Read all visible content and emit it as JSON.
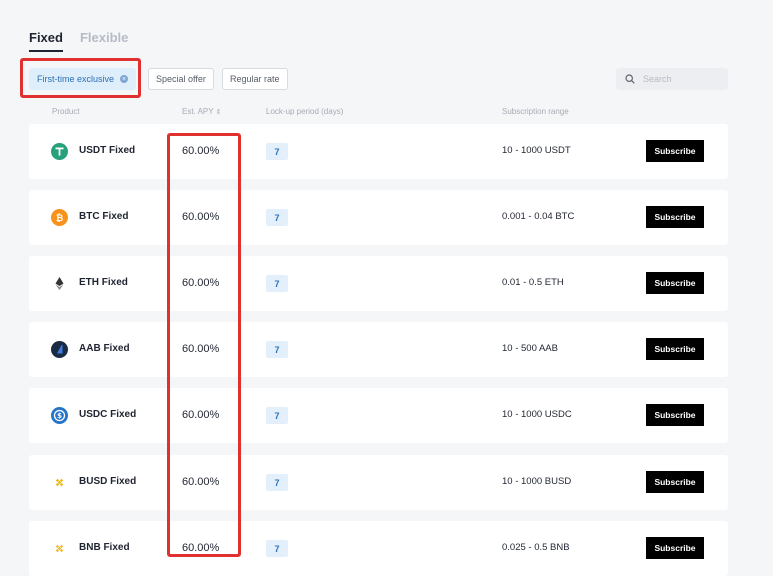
{
  "tabs": [
    {
      "label": "Fixed",
      "active": true
    },
    {
      "label": "Flexible",
      "active": false
    }
  ],
  "filters": [
    {
      "label": "First-time exclusive",
      "active": true
    },
    {
      "label": "Special offer",
      "active": false
    },
    {
      "label": "Regular rate",
      "active": false
    }
  ],
  "search": {
    "placeholder": "Search"
  },
  "columns": {
    "product": "Product",
    "apy": "Est. APY",
    "lockup": "Lock-up period (days)",
    "range": "Subscription range"
  },
  "rows": [
    {
      "name": "USDT Fixed",
      "apy": "60.00%",
      "lockup": "7",
      "range": "10 - 1000 USDT",
      "action": "Subscribe",
      "icon": "usdt-icon",
      "color": "#26a17b"
    },
    {
      "name": "BTC Fixed",
      "apy": "60.00%",
      "lockup": "7",
      "range": "0.001 - 0.04 BTC",
      "action": "Subscribe",
      "icon": "btc-icon",
      "color": "#f7931a"
    },
    {
      "name": "ETH Fixed",
      "apy": "60.00%",
      "lockup": "7",
      "range": "0.01 - 0.5 ETH",
      "action": "Subscribe",
      "icon": "eth-icon",
      "color": "#343434"
    },
    {
      "name": "AAB Fixed",
      "apy": "60.00%",
      "lockup": "7",
      "range": "10 - 500 AAB",
      "action": "Subscribe",
      "icon": "aab-icon",
      "color": "#1a2b44"
    },
    {
      "name": "USDC Fixed",
      "apy": "60.00%",
      "lockup": "7",
      "range": "10 - 1000 USDC",
      "action": "Subscribe",
      "icon": "usdc-icon",
      "color": "#2775ca"
    },
    {
      "name": "BUSD Fixed",
      "apy": "60.00%",
      "lockup": "7",
      "range": "10 - 1000 BUSD",
      "action": "Subscribe",
      "icon": "busd-icon",
      "color": "#f0b90b"
    },
    {
      "name": "BNB Fixed",
      "apy": "60.00%",
      "lockup": "7",
      "range": "0.025 - 0.5 BNB",
      "action": "Subscribe",
      "icon": "bnb-icon",
      "color": "#f3ba2f"
    }
  ]
}
